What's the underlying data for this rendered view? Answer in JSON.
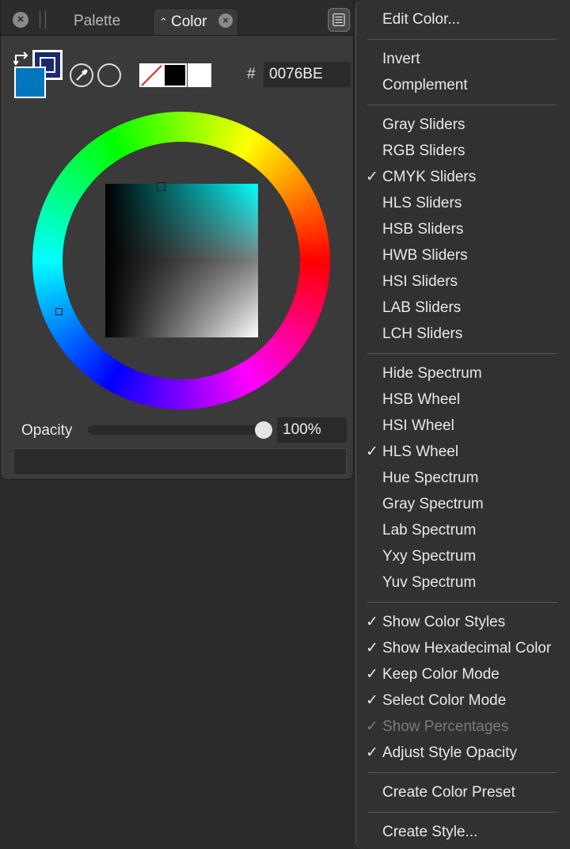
{
  "panel": {
    "tabs": [
      {
        "label": "Palette",
        "active": false
      },
      {
        "label": "Color",
        "active": true
      }
    ],
    "hex_prefix": "#",
    "hex_value": "0076BE",
    "fill_color": "#0076BE",
    "opacity_label": "Opacity",
    "opacity_value": "100%",
    "opacity_fraction": 1.0,
    "icons": {
      "panel_close": "close-icon",
      "tab_arrows": "up-down-arrows-icon",
      "menu": "menu-icon",
      "swap": "swap-arrows-icon",
      "eyedropper": "eyedropper-icon"
    }
  },
  "menu": {
    "items": [
      {
        "label": "Edit Color...",
        "checked": false,
        "enabled": true
      },
      {
        "separator": true
      },
      {
        "label": "Invert",
        "checked": false,
        "enabled": true
      },
      {
        "label": "Complement",
        "checked": false,
        "enabled": true
      },
      {
        "separator": true
      },
      {
        "label": "Gray Sliders",
        "checked": false,
        "enabled": true
      },
      {
        "label": "RGB Sliders",
        "checked": false,
        "enabled": true
      },
      {
        "label": "CMYK Sliders",
        "checked": true,
        "enabled": true
      },
      {
        "label": "HLS Sliders",
        "checked": false,
        "enabled": true
      },
      {
        "label": "HSB Sliders",
        "checked": false,
        "enabled": true
      },
      {
        "label": "HWB Sliders",
        "checked": false,
        "enabled": true
      },
      {
        "label": "HSI Sliders",
        "checked": false,
        "enabled": true
      },
      {
        "label": "LAB Sliders",
        "checked": false,
        "enabled": true
      },
      {
        "label": "LCH Sliders",
        "checked": false,
        "enabled": true
      },
      {
        "separator": true
      },
      {
        "label": "Hide Spectrum",
        "checked": false,
        "enabled": true
      },
      {
        "label": "HSB Wheel",
        "checked": false,
        "enabled": true
      },
      {
        "label": "HSI Wheel",
        "checked": false,
        "enabled": true
      },
      {
        "label": "HLS Wheel",
        "checked": true,
        "enabled": true
      },
      {
        "label": "Hue Spectrum",
        "checked": false,
        "enabled": true
      },
      {
        "label": "Gray Spectrum",
        "checked": false,
        "enabled": true
      },
      {
        "label": "Lab Spectrum",
        "checked": false,
        "enabled": true
      },
      {
        "label": "Yxy Spectrum",
        "checked": false,
        "enabled": true
      },
      {
        "label": "Yuv Spectrum",
        "checked": false,
        "enabled": true
      },
      {
        "separator": true
      },
      {
        "label": "Show Color Styles",
        "checked": true,
        "enabled": true
      },
      {
        "label": "Show Hexadecimal Color",
        "checked": true,
        "enabled": true
      },
      {
        "label": "Keep Color Mode",
        "checked": true,
        "enabled": true
      },
      {
        "label": "Select Color Mode",
        "checked": true,
        "enabled": true
      },
      {
        "label": "Show Percentages",
        "checked": true,
        "enabled": false
      },
      {
        "label": "Adjust Style Opacity",
        "checked": true,
        "enabled": true
      },
      {
        "separator": true
      },
      {
        "label": "Create Color Preset",
        "checked": false,
        "enabled": true
      },
      {
        "separator": true
      },
      {
        "label": "Create Style...",
        "checked": false,
        "enabled": true
      }
    ],
    "check_glyph": "✓"
  }
}
